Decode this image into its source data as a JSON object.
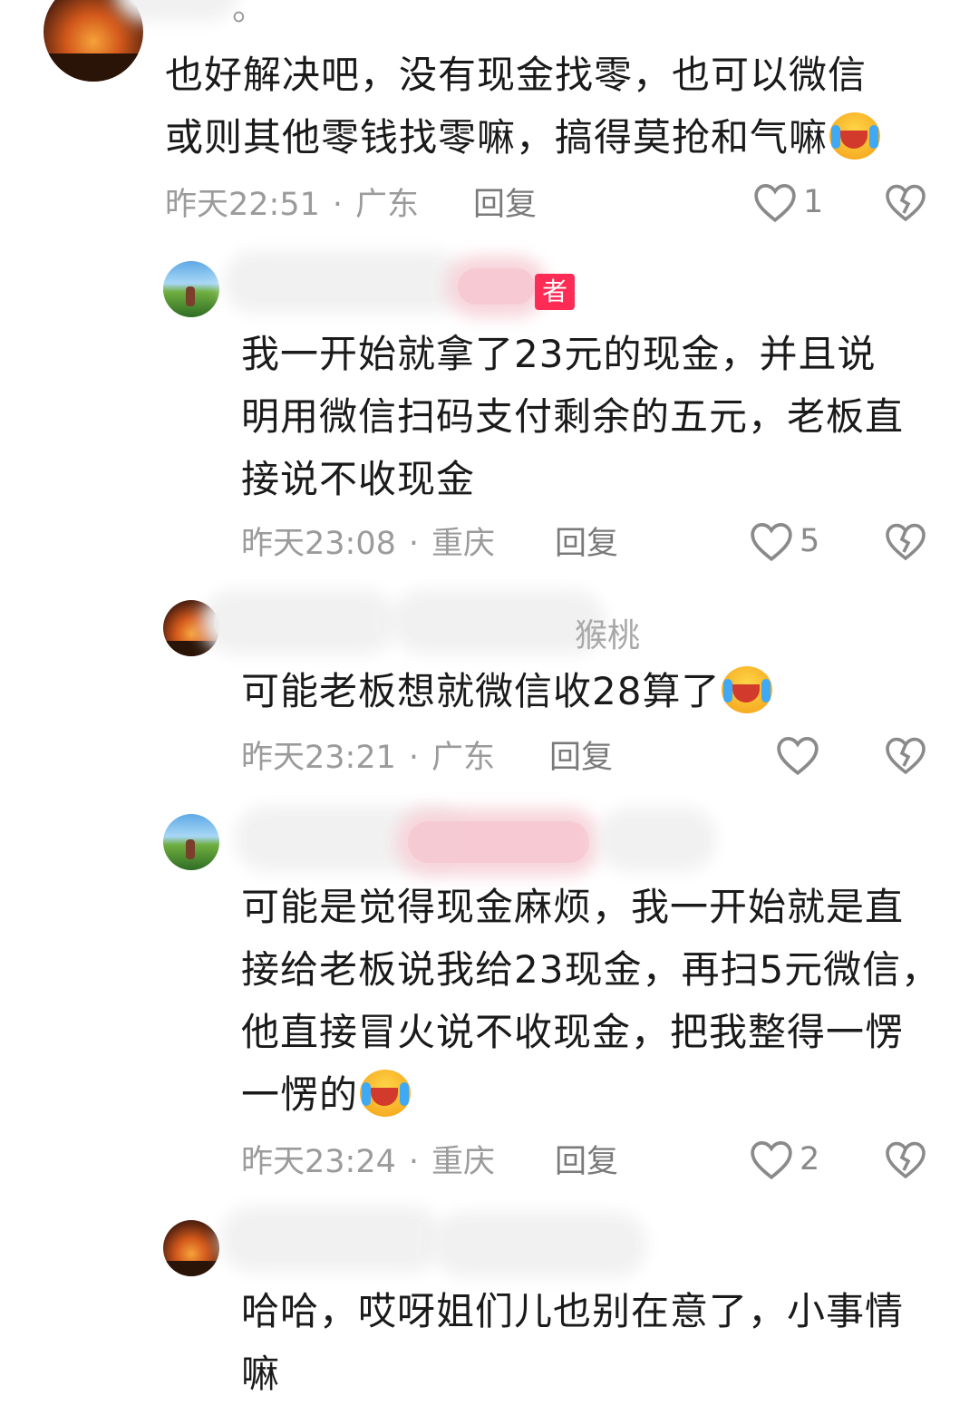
{
  "comments": [
    {
      "text_lines": [
        "也好解决吧，没有现金找零，也可以微信",
        "或则其他零钱找零嘛，搞得莫抢和气嘛"
      ],
      "emoji": "crying-laughing-emoji",
      "time": "昨天22:51",
      "location": "广东",
      "reply": "回复",
      "likes": "1"
    },
    {
      "author_badge": "者",
      "text_lines": [
        "我一开始就拿了23元的现金，并且说",
        "明用微信扫码支付剩余的五元，老板直",
        "接说不收现金"
      ],
      "time": "昨天23:08",
      "location": "重庆",
      "reply": "回复",
      "likes": "5"
    },
    {
      "name_fragment": "猴桃",
      "text_lines": [
        "可能老板想就微信收28算了"
      ],
      "emoji": "crying-laughing-emoji",
      "time": "昨天23:21",
      "location": "广东",
      "reply": "回复",
      "likes": ""
    },
    {
      "text_lines": [
        "可能是觉得现金麻烦，我一开始就是直",
        "接给老板说我给23现金，再扫5元微信，",
        "他直接冒火说不收现金，把我整得一愣",
        "一愣的"
      ],
      "emoji": "crying-laughing-emoji",
      "time": "昨天23:24",
      "location": "重庆",
      "reply": "回复",
      "likes": "2"
    },
    {
      "text_lines": [
        "哈哈，哎呀姐们儿也别在意了，小事情",
        "嘛"
      ]
    }
  ],
  "top_fragment": "。",
  "dot": "·"
}
